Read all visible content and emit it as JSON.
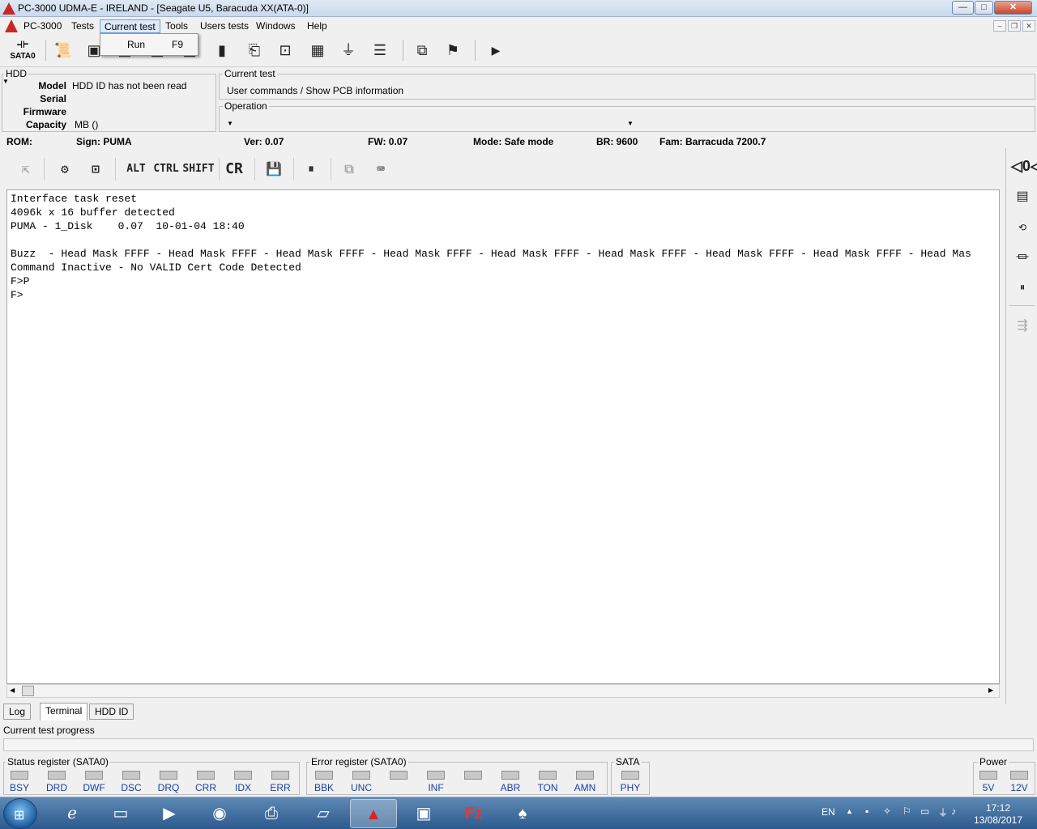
{
  "window": {
    "title": "PC-3000 UDMA-E - IRELAND - [Seagate U5, Baracuda XX(ATA-0)]",
    "controls": {
      "minimize": "—",
      "maximize": "□",
      "close": "✕"
    }
  },
  "menu": {
    "items": [
      "PC-3000",
      "Tests",
      "Current test",
      "Tools",
      "Users tests",
      "Windows",
      "Help"
    ],
    "open_item": "Current test",
    "dropdown": {
      "label": "Run",
      "shortcut": "F9"
    },
    "mdi_controls": {
      "minimize": "–",
      "restore": "❐",
      "close": "✕"
    }
  },
  "toolbar": {
    "sata_label": "SATA0"
  },
  "hdd": {
    "group_label": "HDD",
    "model_label": "Model",
    "model_value": "HDD ID has not been read",
    "serial_label": "Serial",
    "serial_value": "",
    "firmware_label": "Firmware",
    "firmware_value": "",
    "capacity_label": "Capacity",
    "capacity_value": "MB ()"
  },
  "current_test": {
    "group_label": "Current test",
    "value": "User commands / Show PCB information"
  },
  "operation": {
    "group_label": "Operation",
    "value": ""
  },
  "info": {
    "rom": "ROM:",
    "sign": "Sign: PUMA",
    "ver": "Ver: 0.07",
    "fw": "FW: 0.07",
    "mode": "Mode: Safe mode",
    "br": "BR: 9600",
    "fam": "Fam: Barracuda 7200.7"
  },
  "terminal_toolbar": {
    "alt": "ALT",
    "ctrl": "CTRL",
    "shift": "SHIFT",
    "cr": "CR"
  },
  "terminal": {
    "lines": [
      "Interface task reset",
      "4096k x 16 buffer detected",
      "PUMA - 1_Disk    0.07  10-01-04 18:40",
      "",
      "Buzz  - Head Mask FFFF - Head Mask FFFF - Head Mask FFFF - Head Mask FFFF - Head Mask FFFF - Head Mask FFFF - Head Mask FFFF - Head Mask FFFF - Head Mas",
      "Command Inactive - No VALID Cert Code Detected",
      "F>P",
      "F>"
    ]
  },
  "tabs": [
    "Log",
    "Terminal",
    "HDD ID"
  ],
  "active_tab": "Terminal",
  "progress": {
    "label": "Current test progress",
    "value": 0
  },
  "status_register": {
    "label": "Status register (SATA0)",
    "bits": [
      "BSY",
      "DRD",
      "DWF",
      "DSC",
      "DRQ",
      "CRR",
      "IDX",
      "ERR"
    ]
  },
  "error_register": {
    "label": "Error register (SATA0)",
    "bits": [
      "BBK",
      "UNC",
      "",
      "INF",
      "",
      "ABR",
      "TON",
      "AMN"
    ]
  },
  "sata": {
    "label": "SATA",
    "bits": [
      "PHY"
    ]
  },
  "power": {
    "label": "Power",
    "bits": [
      "5V",
      "12V"
    ]
  },
  "taskbar": {
    "lang": "EN",
    "time": "17:12",
    "date": "13/08/2017"
  },
  "icons": {
    "sata": "sata-connector-icon",
    "colors": {
      "led_off": "#c8c8c8",
      "register_label": "#1b3fa0",
      "taskbar": "#2c5a8e"
    }
  }
}
